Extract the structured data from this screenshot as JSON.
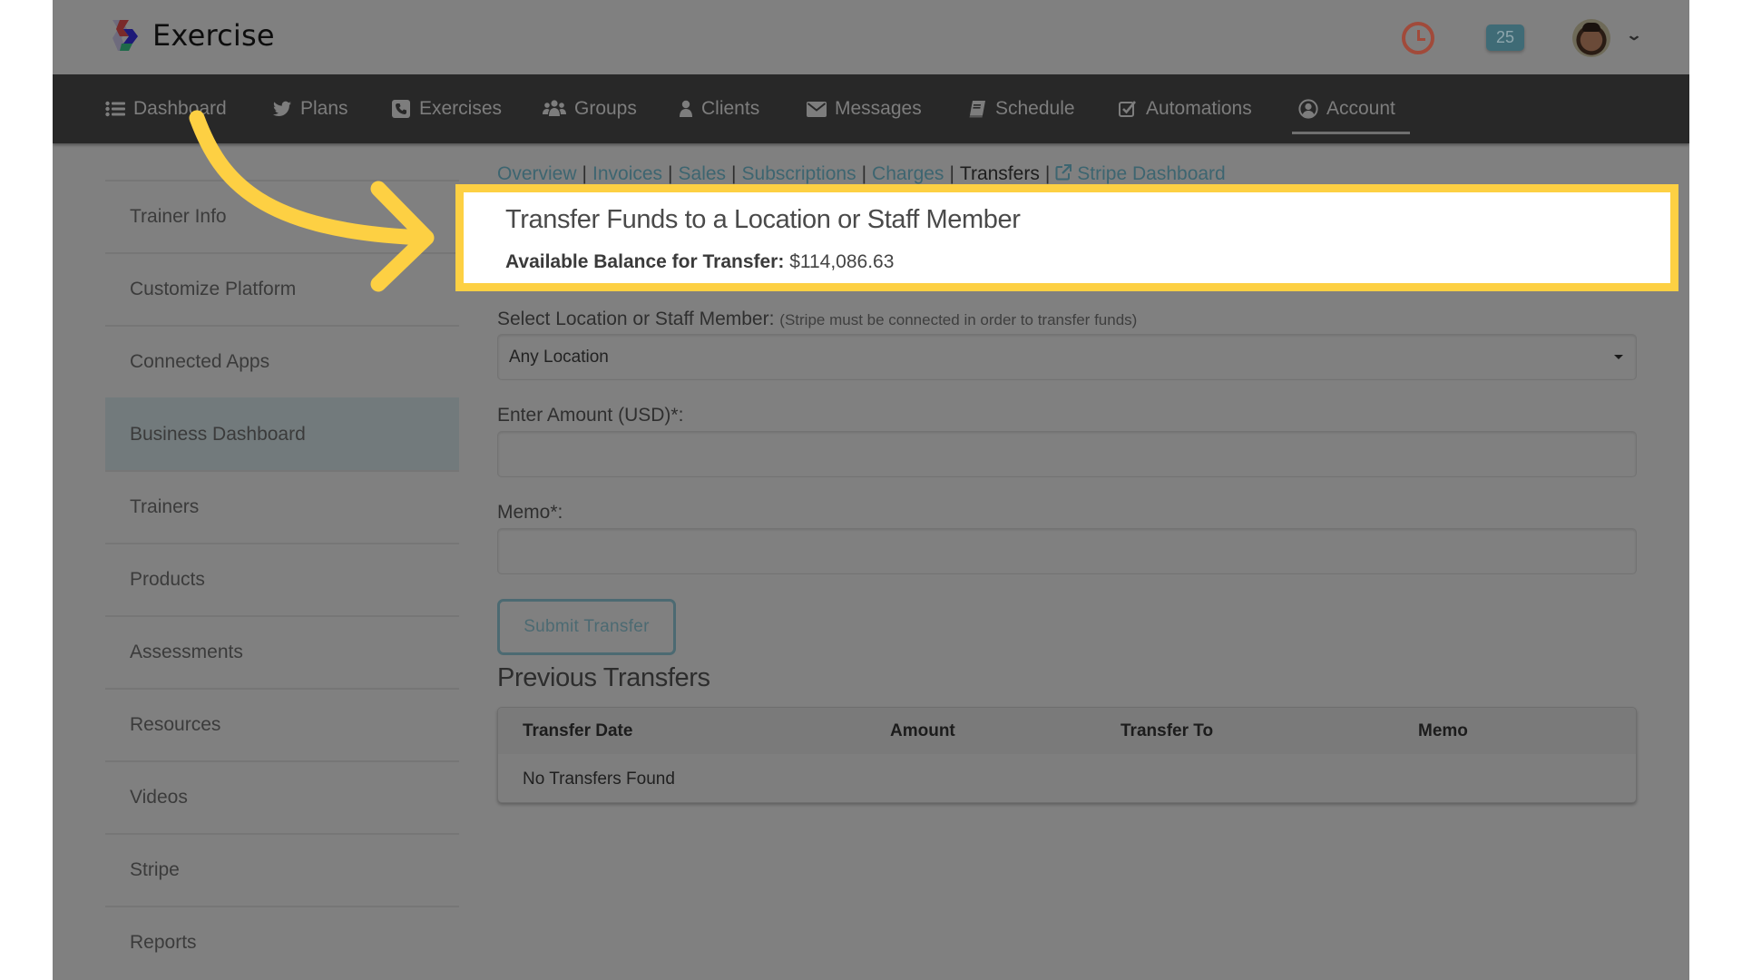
{
  "header": {
    "app_name": "Exercise",
    "notification_count": "25",
    "icons": {
      "logo": "exercise-logo-icon",
      "clock": "clock-icon",
      "avatar": "user-avatar",
      "caret": "chevron-down-icon"
    }
  },
  "nav": {
    "items": [
      {
        "label": "Dashboard",
        "icon": "list-icon"
      },
      {
        "label": "Plans",
        "icon": "twitter-bird-icon"
      },
      {
        "label": "Exercises",
        "icon": "phone-square-icon"
      },
      {
        "label": "Groups",
        "icon": "users-icon"
      },
      {
        "label": "Clients",
        "icon": "user-icon"
      },
      {
        "label": "Messages",
        "icon": "envelope-icon"
      },
      {
        "label": "Schedule",
        "icon": "book-icon"
      },
      {
        "label": "Automations",
        "icon": "check-square-icon"
      },
      {
        "label": "Account",
        "icon": "user-circle-icon"
      }
    ],
    "active": "Account"
  },
  "sidebar": {
    "items": [
      {
        "label": "Trainer Info"
      },
      {
        "label": "Customize Platform"
      },
      {
        "label": "Connected Apps"
      },
      {
        "label": "Business Dashboard"
      },
      {
        "label": "Trainers"
      },
      {
        "label": "Products"
      },
      {
        "label": "Assessments"
      },
      {
        "label": "Resources"
      },
      {
        "label": "Videos"
      },
      {
        "label": "Stripe"
      },
      {
        "label": "Reports"
      }
    ],
    "active": "Business Dashboard"
  },
  "subnav": {
    "overview": "Overview",
    "invoices": "Invoices",
    "sales": "Sales",
    "subscriptions": "Subscriptions",
    "charges": "Charges",
    "transfers": "Transfers",
    "stripe_dashboard": "Stripe Dashboard",
    "separator": "|"
  },
  "transfer": {
    "title": "Transfer Funds to a Location or Staff Member",
    "balance_label": "Available Balance for Transfer:",
    "balance_value": "$114,086.63"
  },
  "form": {
    "location_label": "Select Location or Staff Member:",
    "location_hint": "(Stripe must be connected in order to transfer funds)",
    "location_value": "Any Location",
    "amount_label": "Enter Amount (USD)*:",
    "amount_value": "",
    "memo_label": "Memo*:",
    "memo_value": "",
    "submit_label": "Submit Transfer"
  },
  "previous": {
    "title": "Previous Transfers",
    "columns": [
      "Transfer Date",
      "Amount",
      "Transfer To",
      "Memo"
    ],
    "empty_message": "No Transfers Found"
  },
  "colors": {
    "highlight": "#fdd043",
    "nav_bg": "#282828",
    "overlay_bg": "#808080",
    "link": "#3d6570"
  }
}
